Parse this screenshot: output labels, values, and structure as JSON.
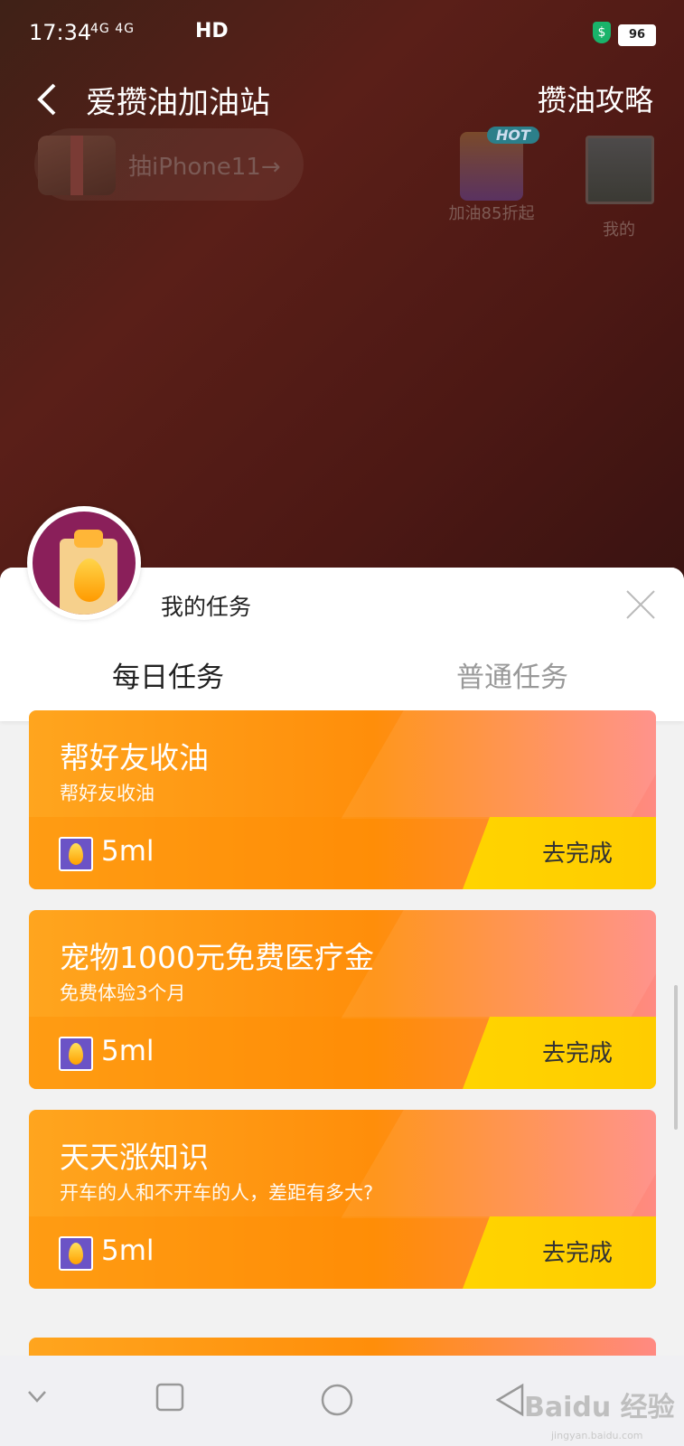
{
  "status_bar": {
    "time": "17:34",
    "network": "4G 4G",
    "hd": "HD",
    "battery": "96",
    "shield": "$"
  },
  "header": {
    "title": "爱攒油加油站",
    "guide": "攒油攻略"
  },
  "promo": {
    "label": "抽iPhone11→"
  },
  "side_icons": [
    {
      "badge": "HOT",
      "label": "加油85折起"
    },
    {
      "label": "我的"
    }
  ],
  "panel": {
    "title": "我的任务",
    "tabs": [
      {
        "label": "每日任务",
        "active": true
      },
      {
        "label": "普通任务",
        "active": false
      }
    ]
  },
  "tasks": [
    {
      "title": "帮好友收油",
      "subtitle": "帮好友收油",
      "reward": "5ml",
      "action": "去完成"
    },
    {
      "title": "宠物1000元免费医疗金",
      "subtitle": "免费体验3个月",
      "reward": "5ml",
      "action": "去完成"
    },
    {
      "title": "天天涨知识",
      "subtitle": "开车的人和不开车的人，差距有多大?",
      "reward": "5ml",
      "action": "去完成"
    }
  ],
  "watermark": {
    "text": "Baidu 经验",
    "sub": "jingyan.baidu.com"
  },
  "colors": {
    "accent_red": "#ef3a26",
    "card_orange": "#ff8e0a",
    "button_yellow": "#ffd400"
  }
}
